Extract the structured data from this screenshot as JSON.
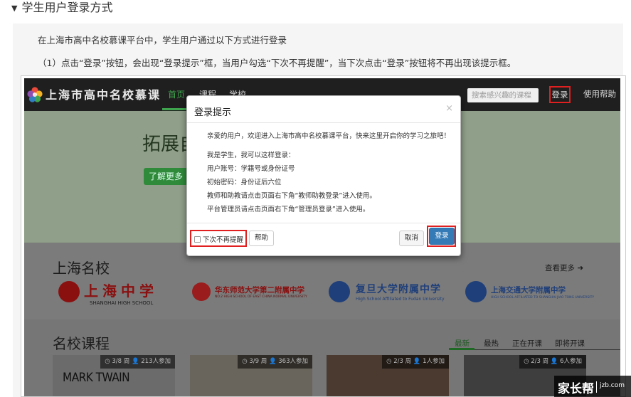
{
  "section": {
    "toggle_glyph": "▼",
    "title": "学生用户登录方式"
  },
  "intro": {
    "line1": "在上海市高中名校慕课平台中，学生用户通过以下方式进行登录",
    "line2": "（1）点击“登录”按钮，会出现“登录提示”框，当用户勾选“下次不再提醒”，当下次点击“登录”按钮将不再出现该提示框。"
  },
  "site": {
    "nav": {
      "logo_text": "上海市高中名校慕课",
      "items": [
        "首页",
        "课程",
        "学校"
      ],
      "search_placeholder": "搜索感兴趣的课程",
      "login_label": "登录",
      "help_label": "使用帮助"
    },
    "hero": {
      "title": "拓展自",
      "button_label": "了解更多"
    },
    "schools": {
      "title": "上海名校",
      "more_label": "查看更多",
      "list": [
        {
          "name": "上海中学",
          "sub": "SHANGHAI HIGH SCHOOL"
        },
        {
          "name": "华东师范大学第二附属中学",
          "sub": "NO.2 HIGH SCHOOL OF EAST CHINA NORMAL UNIVERSITY"
        },
        {
          "name": "复旦大学附属中学",
          "sub": "High School Affiliated to Fudan University"
        },
        {
          "name": "上海交通大学附属中学",
          "sub": "HIGH SCHOOL AFFILIATED TO SHANGHAI JIAO TONG UNIVERSITY"
        }
      ]
    },
    "courses": {
      "title": "名校课程",
      "filters": [
        "最新",
        "最热",
        "正在开课",
        "即将开课"
      ],
      "cards": [
        {
          "meta": "◷ 3/8 周  👤 213人参加",
          "text": "MARK TWAIN"
        },
        {
          "meta": "◷ 3/9 周  👤 363人参加",
          "text": ""
        },
        {
          "meta": "◷ 2/3 周  👤 1人参加",
          "text": ""
        },
        {
          "meta": "◷ 2/3 周  👤 6人参加",
          "text": ""
        }
      ]
    }
  },
  "modal": {
    "title": "登录提示",
    "close_glyph": "×",
    "lines": [
      "亲爱的用户，欢迎进入上海市高中名校慕课平台，快来这里开启你的学习之旅吧！",
      "我是学生，我可以这样登录：",
      "用户账号：学籍号或身份证号",
      "初始密码：身份证后六位",
      "教师和助教请点击页面右下角“教师助教登录”进入使用。",
      "平台管理员请点击页面右下角“管理员登录”进入使用。"
    ],
    "no_remind_label": "下次不再提醒",
    "help_button": "帮助",
    "cancel_button": "取消",
    "login_button": "登录"
  },
  "watermark": {
    "main": "家长帮",
    "sub": "jzb.com"
  },
  "colors": {
    "accent_green": "#3ea44d",
    "highlight_red": "#e02020",
    "primary_blue": "#337ab7"
  }
}
